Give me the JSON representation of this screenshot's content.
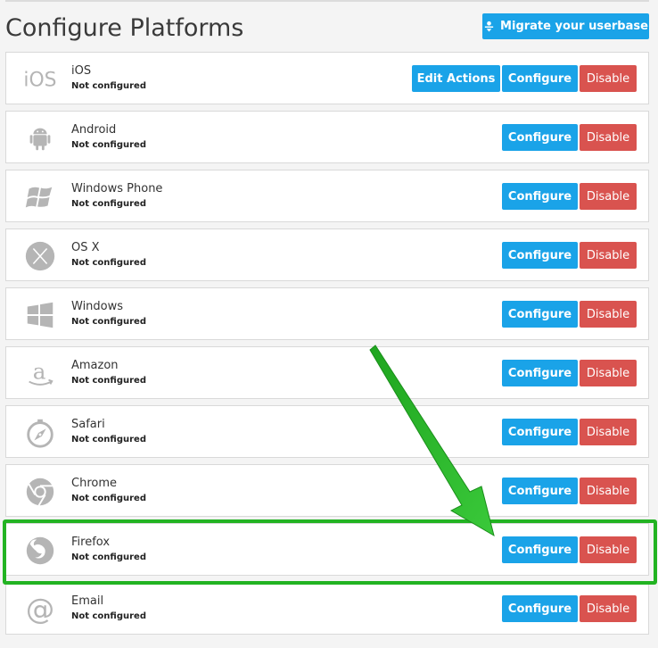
{
  "header": {
    "title": "Configure Platforms",
    "migrate_label": "Migrate your userbase"
  },
  "labels": {
    "edit_actions": "Edit Actions",
    "configure": "Configure",
    "disable": "Disable"
  },
  "platforms": [
    {
      "name": "iOS",
      "status": "Not configured",
      "icon": "ios-icon",
      "has_edit_actions": true
    },
    {
      "name": "Android",
      "status": "Not configured",
      "icon": "android-icon"
    },
    {
      "name": "Windows Phone",
      "status": "Not configured",
      "icon": "windows-phone-icon"
    },
    {
      "name": "OS X",
      "status": "Not configured",
      "icon": "osx-icon"
    },
    {
      "name": "Windows",
      "status": "Not configured",
      "icon": "windows-icon"
    },
    {
      "name": "Amazon",
      "status": "Not configured",
      "icon": "amazon-icon"
    },
    {
      "name": "Safari",
      "status": "Not configured",
      "icon": "safari-icon"
    },
    {
      "name": "Chrome",
      "status": "Not configured",
      "icon": "chrome-icon"
    },
    {
      "name": "Firefox",
      "status": "Not configured",
      "icon": "firefox-icon",
      "highlighted": true
    },
    {
      "name": "Email",
      "status": "Not configured",
      "icon": "email-icon"
    }
  ],
  "colors": {
    "primary": "#1aa3e8",
    "danger": "#d9534f",
    "highlight": "#22b322",
    "icon_gray": "#b5b5b5"
  },
  "ios_logo_text": "iOS"
}
